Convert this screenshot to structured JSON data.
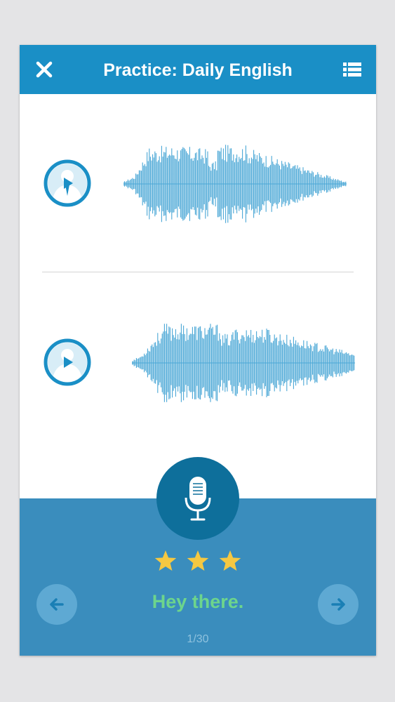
{
  "header": {
    "title": "Practice: Daily English",
    "close_icon": "close-icon",
    "menu_icon": "list-icon"
  },
  "recordings": [
    {
      "speaker": "native-speaker",
      "icon": "play-icon"
    },
    {
      "speaker": "user",
      "icon": "play-icon"
    }
  ],
  "practice": {
    "rating": 3,
    "rating_max": 3,
    "phrase": "Hey there.",
    "counter": "1/30",
    "mic_icon": "microphone-icon",
    "prev_icon": "arrow-left-icon",
    "next_icon": "arrow-right-icon"
  },
  "colors": {
    "header": "#1a8fc6",
    "wave": "#4aa7d6",
    "panel": "#3a8dbd",
    "mic": "#0e6f9b",
    "phrase": "#6dd58c",
    "star": "#f5c842"
  }
}
